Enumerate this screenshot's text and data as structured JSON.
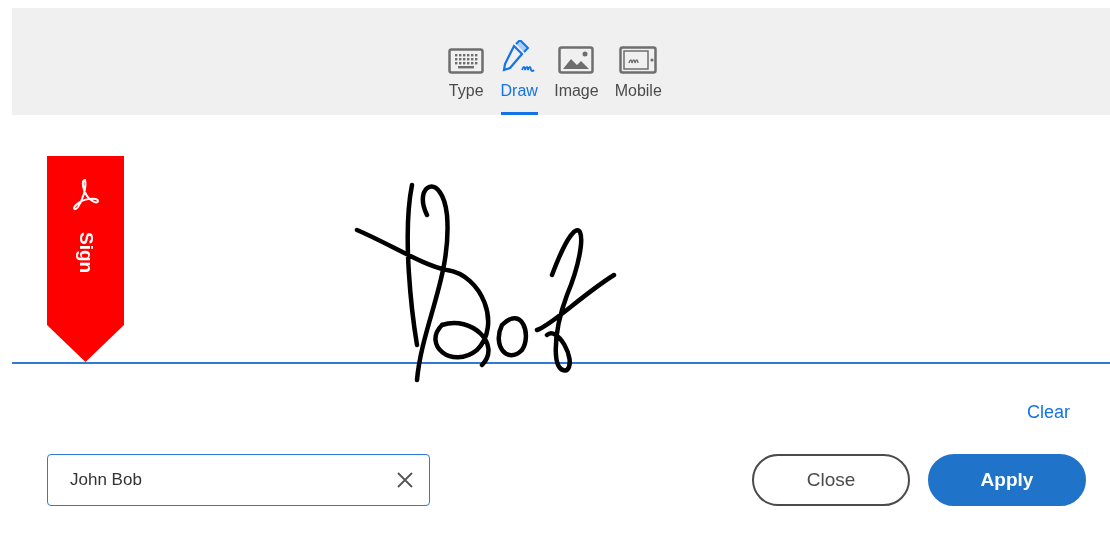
{
  "tabs": [
    {
      "label": "Type",
      "kind": "keyboard",
      "selected": false
    },
    {
      "label": "Draw",
      "kind": "pen",
      "selected": true
    },
    {
      "label": "Image",
      "kind": "image",
      "selected": false
    },
    {
      "label": "Mobile",
      "kind": "mobile",
      "selected": false
    }
  ],
  "badge": {
    "label": "Sign"
  },
  "clear": "Clear",
  "name_field": {
    "value": "John Bob"
  },
  "buttons": [
    {
      "label": "Close",
      "kind": "secondary"
    },
    {
      "label": "Apply",
      "kind": "primary"
    }
  ]
}
